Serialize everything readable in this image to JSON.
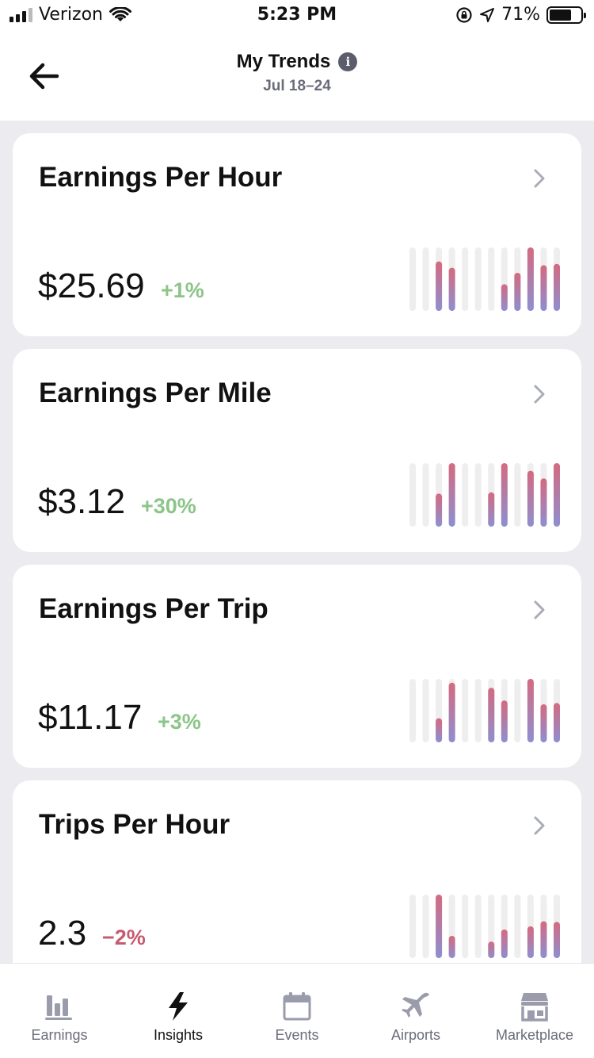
{
  "status_bar": {
    "carrier": "Verizon",
    "time": "5:23 PM",
    "battery": "71%",
    "battery_level": 0.71,
    "icons": [
      "signal-icon",
      "wifi-icon",
      "orientation-lock-icon",
      "location-arrow-icon",
      "battery-icon"
    ]
  },
  "header": {
    "title": "My Trends",
    "subtitle": "Jul 18–24",
    "back_icon": "arrow-left-icon",
    "info_icon": "info-icon"
  },
  "cards": [
    {
      "title": "Earnings Per Hour",
      "value": "$25.69",
      "change": "+1%",
      "trend": "up",
      "bars": [
        0,
        0,
        0.78,
        0.68,
        0,
        0,
        0,
        0.42,
        0.6,
        1.0,
        0.72,
        0.74
      ]
    },
    {
      "title": "Earnings Per Mile",
      "value": "$3.12",
      "change": "+30%",
      "trend": "up",
      "bars": [
        0,
        0,
        0.52,
        1.0,
        0,
        0,
        0.54,
        1.0,
        0,
        0.88,
        0.76,
        1.0
      ]
    },
    {
      "title": "Earnings Per Trip",
      "value": "$11.17",
      "change": "+3%",
      "trend": "up",
      "bars": [
        0,
        0,
        0.38,
        0.94,
        0,
        0,
        0.86,
        0.66,
        0,
        1.0,
        0.6,
        0.62
      ]
    },
    {
      "title": "Trips Per Hour",
      "value": "2.3",
      "change": "−2%",
      "trend": "down",
      "bars": [
        0,
        0,
        1.0,
        0.35,
        0,
        0,
        0.26,
        0.45,
        0,
        0.5,
        0.58,
        0.57
      ]
    }
  ],
  "tabs": [
    {
      "label": "Earnings",
      "icon": "bar-chart-icon",
      "active": false
    },
    {
      "label": "Insights",
      "icon": "lightning-bolt-icon",
      "active": true
    },
    {
      "label": "Events",
      "icon": "calendar-icon",
      "active": false
    },
    {
      "label": "Airports",
      "icon": "airplane-icon",
      "active": false
    },
    {
      "label": "Marketplace",
      "icon": "storefront-icon",
      "active": false
    }
  ],
  "colors": {
    "positive": "#8CC588",
    "negative": "#C65A70",
    "bar_top": "#D46A80",
    "bar_bottom": "#8E8FD0",
    "bar_track": "#EEEEEE",
    "icon_inactive": "#9A9CAB",
    "icon_active": "#111111"
  }
}
